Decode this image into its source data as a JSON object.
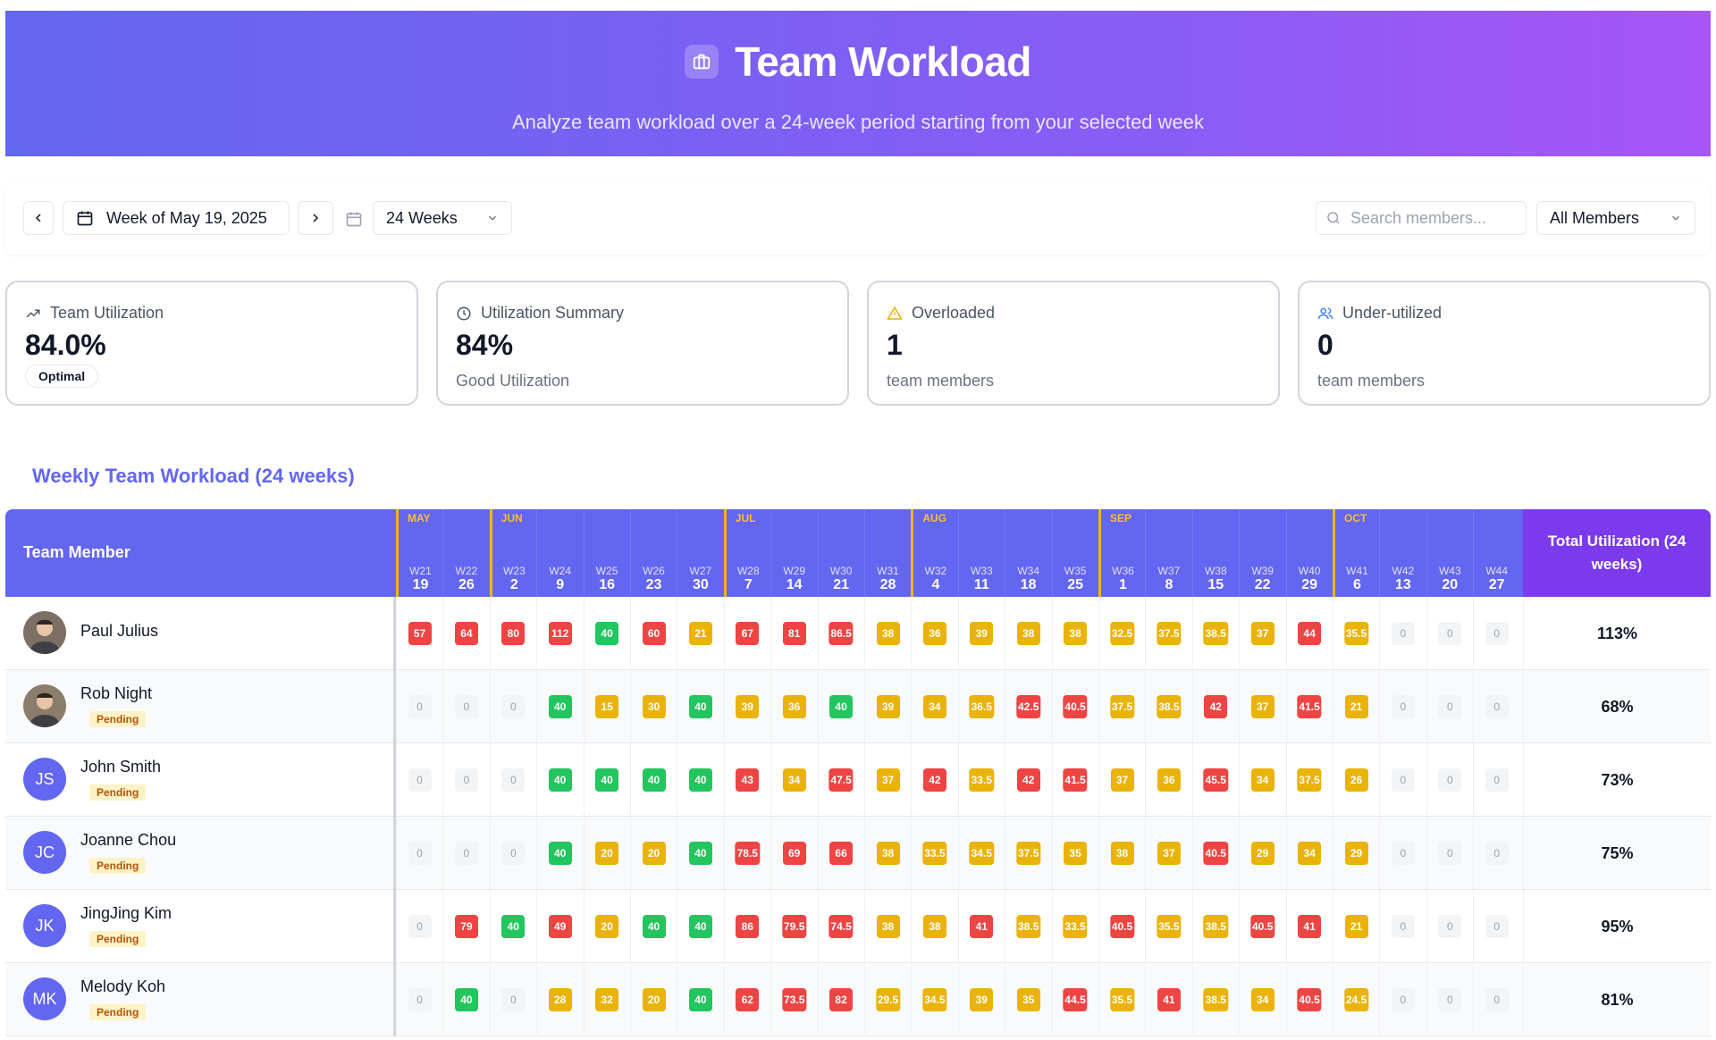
{
  "header": {
    "title": "Team Workload",
    "subtitle": "Analyze team workload over a 24-week period starting from your selected week",
    "icon": "briefcase-icon"
  },
  "toolbar": {
    "week_label": "Week of May 19, 2025",
    "range_label": "24 Weeks",
    "search_placeholder": "Search members...",
    "filter_label": "All Members"
  },
  "stats": {
    "team_utilization": {
      "label": "Team Utilization",
      "value": "84.0%",
      "badge": "Optimal"
    },
    "summary": {
      "label": "Utilization Summary",
      "value": "84%",
      "note": "Good Utilization"
    },
    "overloaded": {
      "label": "Overloaded",
      "value": "1",
      "note": "team members"
    },
    "underutilized": {
      "label": "Under-utilized",
      "value": "0",
      "note": "team members"
    }
  },
  "section_title": "Weekly Team Workload (24 weeks)",
  "table": {
    "member_header": "Team Member",
    "total_header": "Total Utilization (24 weeks)",
    "weeks": [
      {
        "w": "W21",
        "d": "19",
        "m": "MAY"
      },
      {
        "w": "W22",
        "d": "26",
        "m": ""
      },
      {
        "w": "W23",
        "d": "2",
        "m": "JUN"
      },
      {
        "w": "W24",
        "d": "9",
        "m": ""
      },
      {
        "w": "W25",
        "d": "16",
        "m": ""
      },
      {
        "w": "W26",
        "d": "23",
        "m": ""
      },
      {
        "w": "W27",
        "d": "30",
        "m": ""
      },
      {
        "w": "W28",
        "d": "7",
        "m": "JUL"
      },
      {
        "w": "W29",
        "d": "14",
        "m": ""
      },
      {
        "w": "W30",
        "d": "21",
        "m": ""
      },
      {
        "w": "W31",
        "d": "28",
        "m": ""
      },
      {
        "w": "W32",
        "d": "4",
        "m": "AUG"
      },
      {
        "w": "W33",
        "d": "11",
        "m": ""
      },
      {
        "w": "W34",
        "d": "18",
        "m": ""
      },
      {
        "w": "W35",
        "d": "25",
        "m": ""
      },
      {
        "w": "W36",
        "d": "1",
        "m": "SEP"
      },
      {
        "w": "W37",
        "d": "8",
        "m": ""
      },
      {
        "w": "W38",
        "d": "15",
        "m": ""
      },
      {
        "w": "W39",
        "d": "22",
        "m": ""
      },
      {
        "w": "W40",
        "d": "29",
        "m": ""
      },
      {
        "w": "W41",
        "d": "6",
        "m": "OCT"
      },
      {
        "w": "W42",
        "d": "13",
        "m": ""
      },
      {
        "w": "W43",
        "d": "20",
        "m": ""
      },
      {
        "w": "W44",
        "d": "27",
        "m": ""
      }
    ],
    "members": [
      {
        "name": "Paul Julius",
        "initials": "",
        "photo": true,
        "pending": false,
        "total": "113%",
        "values": [
          "57",
          "64",
          "80",
          "112",
          "40",
          "60",
          "21",
          "67",
          "81",
          "86.5",
          "38",
          "36",
          "39",
          "38",
          "38",
          "32.5",
          "37.5",
          "38.5",
          "37",
          "44",
          "35.5",
          "0",
          "0",
          "0"
        ],
        "colors": [
          "r",
          "r",
          "r",
          "r",
          "g",
          "r",
          "y",
          "r",
          "r",
          "r",
          "y",
          "y",
          "y",
          "y",
          "y",
          "y",
          "y",
          "y",
          "y",
          "r",
          "y",
          "n",
          "n",
          "n"
        ]
      },
      {
        "name": "Rob Night",
        "initials": "",
        "photo": true,
        "pending": true,
        "total": "68%",
        "values": [
          "0",
          "0",
          "0",
          "40",
          "15",
          "30",
          "40",
          "39",
          "36",
          "40",
          "39",
          "34",
          "36.5",
          "42.5",
          "40.5",
          "37.5",
          "38.5",
          "42",
          "37",
          "41.5",
          "21",
          "0",
          "0",
          "0"
        ],
        "colors": [
          "n",
          "n",
          "n",
          "g",
          "y",
          "y",
          "g",
          "y",
          "y",
          "g",
          "y",
          "y",
          "y",
          "r",
          "r",
          "y",
          "y",
          "r",
          "y",
          "r",
          "y",
          "n",
          "n",
          "n"
        ]
      },
      {
        "name": "John Smith",
        "initials": "JS",
        "photo": false,
        "pending": true,
        "total": "73%",
        "values": [
          "0",
          "0",
          "0",
          "40",
          "40",
          "40",
          "40",
          "43",
          "34",
          "47.5",
          "37",
          "42",
          "33.5",
          "42",
          "41.5",
          "37",
          "36",
          "45.5",
          "34",
          "37.5",
          "26",
          "0",
          "0",
          "0"
        ],
        "colors": [
          "n",
          "n",
          "n",
          "g",
          "g",
          "g",
          "g",
          "r",
          "y",
          "r",
          "y",
          "r",
          "y",
          "r",
          "r",
          "y",
          "y",
          "r",
          "y",
          "y",
          "y",
          "n",
          "n",
          "n"
        ]
      },
      {
        "name": "Joanne Chou",
        "initials": "JC",
        "photo": false,
        "pending": true,
        "total": "75%",
        "values": [
          "0",
          "0",
          "0",
          "40",
          "20",
          "20",
          "40",
          "78.5",
          "69",
          "66",
          "38",
          "33.5",
          "34.5",
          "37.5",
          "35",
          "38",
          "37",
          "40.5",
          "29",
          "34",
          "29",
          "0",
          "0",
          "0"
        ],
        "colors": [
          "n",
          "n",
          "n",
          "g",
          "y",
          "y",
          "g",
          "r",
          "r",
          "r",
          "y",
          "y",
          "y",
          "y",
          "y",
          "y",
          "y",
          "r",
          "y",
          "y",
          "y",
          "n",
          "n",
          "n"
        ]
      },
      {
        "name": "JingJing Kim",
        "initials": "JK",
        "photo": false,
        "pending": true,
        "total": "95%",
        "values": [
          "0",
          "79",
          "40",
          "49",
          "20",
          "40",
          "40",
          "86",
          "79.5",
          "74.5",
          "38",
          "38",
          "41",
          "38.5",
          "33.5",
          "40.5",
          "35.5",
          "38.5",
          "40.5",
          "41",
          "21",
          "0",
          "0",
          "0"
        ],
        "colors": [
          "n",
          "r",
          "g",
          "r",
          "y",
          "g",
          "g",
          "r",
          "r",
          "r",
          "y",
          "y",
          "r",
          "y",
          "y",
          "r",
          "y",
          "y",
          "r",
          "r",
          "y",
          "n",
          "n",
          "n"
        ]
      },
      {
        "name": "Melody Koh",
        "initials": "MK",
        "photo": false,
        "pending": true,
        "total": "81%",
        "values": [
          "0",
          "40",
          "0",
          "28",
          "32",
          "20",
          "40",
          "62",
          "73.5",
          "82",
          "29.5",
          "34.5",
          "39",
          "35",
          "44.5",
          "35.5",
          "41",
          "38.5",
          "34",
          "40.5",
          "24.5",
          "0",
          "0",
          "0"
        ],
        "colors": [
          "n",
          "g",
          "n",
          "y",
          "y",
          "y",
          "g",
          "r",
          "r",
          "r",
          "y",
          "y",
          "y",
          "y",
          "r",
          "y",
          "r",
          "y",
          "y",
          "r",
          "y",
          "n",
          "n",
          "n"
        ]
      }
    ],
    "pending_label": "Pending"
  },
  "colors": {
    "accent": "#6366f1",
    "overload": "#ef4444",
    "normal": "#eab308",
    "good": "#22c55e",
    "total_header": "#7c3aed"
  }
}
